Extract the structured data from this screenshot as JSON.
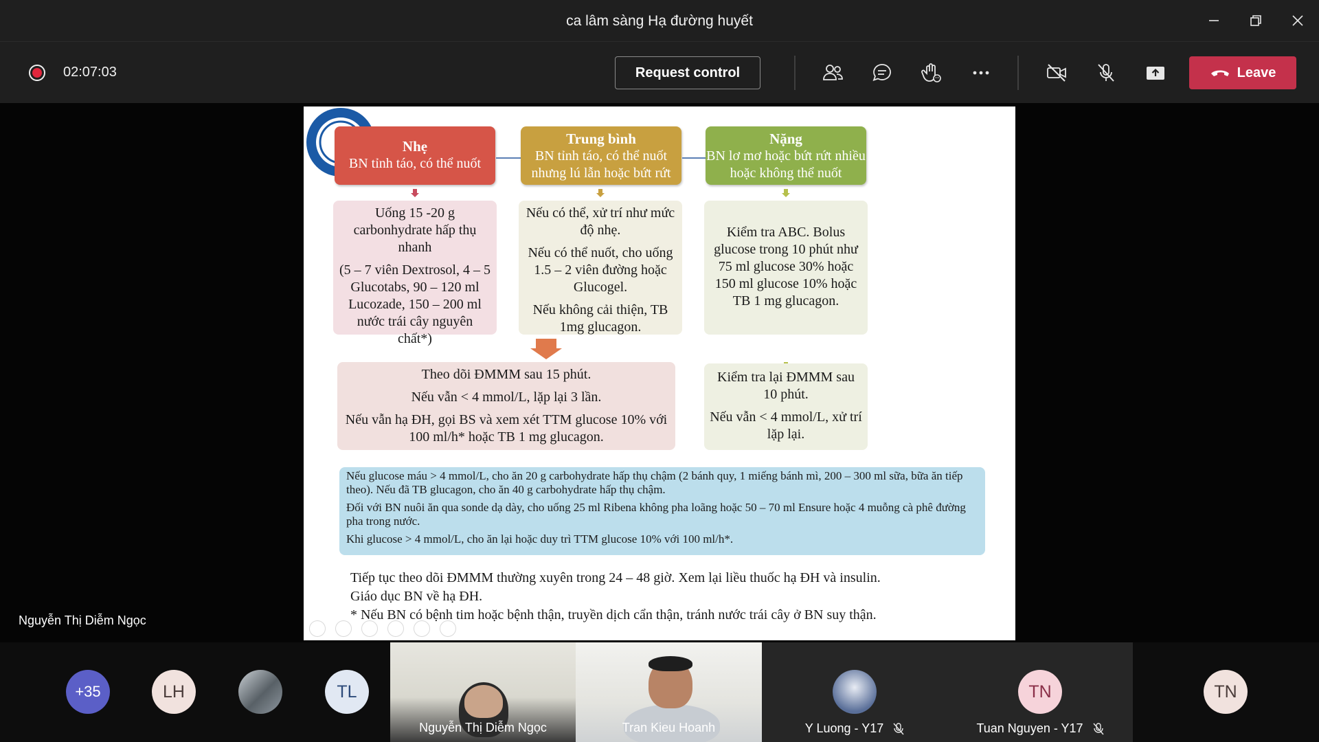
{
  "window": {
    "title": "ca lâm sàng Hạ đường huyết"
  },
  "toolbar": {
    "timer": "02:07:03",
    "request_control_label": "Request control",
    "leave_label": "Leave"
  },
  "stage": {
    "presenter_name": "Nguyễn Thị Diễm Ngọc"
  },
  "slide": {
    "headers": [
      {
        "title": "Nhẹ",
        "desc": "BN tỉnh táo, có thể nuốt"
      },
      {
        "title": "Trung bình",
        "desc": "BN tỉnh táo, có thể nuốt nhưng lú lẫn hoặc bứt rứt"
      },
      {
        "title": "Nặng",
        "desc": "BN lơ mơ hoặc bứt rứt nhiều hoặc không thể nuốt"
      }
    ],
    "mild_step": {
      "p1": "Uống 15 -20 g carbonhydrate hấp thụ nhanh",
      "p2": "(5 – 7 viên Dextrosol, 4 – 5 Glucotabs, 90 – 120 ml Lucozade, 150 – 200 ml nước trái cây nguyên chất*)"
    },
    "moderate_step": {
      "p1": "Nếu có thể, xử trí như mức độ nhẹ.",
      "p2": "Nếu có thể nuốt, cho uống 1.5 – 2 viên đường hoặc Glucogel.",
      "p3": "Nếu không cải thiện, TB 1mg glucagon."
    },
    "severe_step": {
      "p1": "Kiểm tra ABC. Bolus glucose trong 10 phút như 75 ml glucose 30% hoặc 150 ml glucose 10% hoặc TB 1 mg glucagon."
    },
    "monitor_mild": {
      "p1": "Theo dõi ĐMMM sau 15 phút.",
      "p2": "Nếu vẫn < 4 mmol/L, lặp lại 3 lần.",
      "p3": "Nếu vẫn hạ ĐH, gọi BS và xem xét TTM glucose 10% với 100 ml/h* hoặc TB 1 mg glucagon."
    },
    "monitor_severe": {
      "p1": "Kiểm tra lại ĐMMM sau 10 phút.",
      "p2": "Nếu vẫn < 4 mmol/L, xử trí lặp lại."
    },
    "blue_box": {
      "p1": "Nếu glucose máu > 4 mmol/L, cho ăn 20 g carbohydrate hấp thụ chậm (2 bánh quy, 1 miếng bánh mì, 200 – 300 ml sữa, bữa ăn tiếp theo). Nếu đã TB glucagon, cho ăn 40 g carbohydrate hấp thụ chậm.",
      "p2": "Đối với BN nuôi ăn qua sonde dạ dày, cho uống 25 ml Ribena không pha loãng hoặc 50 – 70 ml Ensure hoặc 4 muỗng cà phê đường pha trong nước.",
      "p3": "Khi glucose > 4 mmol/L, cho ăn lại hoặc duy trì TTM glucose 10% với 100 ml/h*."
    },
    "footer": {
      "line1": "Tiếp tục theo dõi ĐMMM thường xuyên trong 24 – 48 giờ. Xem lại liều thuốc hạ ĐH và insulin.",
      "line2": "Giáo dục BN về hạ ĐH.",
      "line3": "* Nếu BN có bệnh tim hoặc bệnh thận, truyền dịch cẩn thận, tránh nước trái cây ở BN suy thận."
    }
  },
  "participants": {
    "more_count": "+35",
    "avatars": [
      "LH",
      "TL"
    ],
    "tiles": [
      {
        "name": "Nguyễn Thị Diễm Ngọc"
      },
      {
        "name": "Tran Kieu Hoanh"
      },
      {
        "name": "Y Luong - Y17"
      },
      {
        "name": "Tuan Nguyen - Y17",
        "initials": "TN"
      }
    ],
    "last_avatar": "TN"
  },
  "colors": {
    "leave": "#c4314b",
    "record": "#e0263c",
    "mild": "#d65548",
    "moderate": "#c8a040",
    "severe": "#8fb04c",
    "info_box": "#bcdeec"
  }
}
